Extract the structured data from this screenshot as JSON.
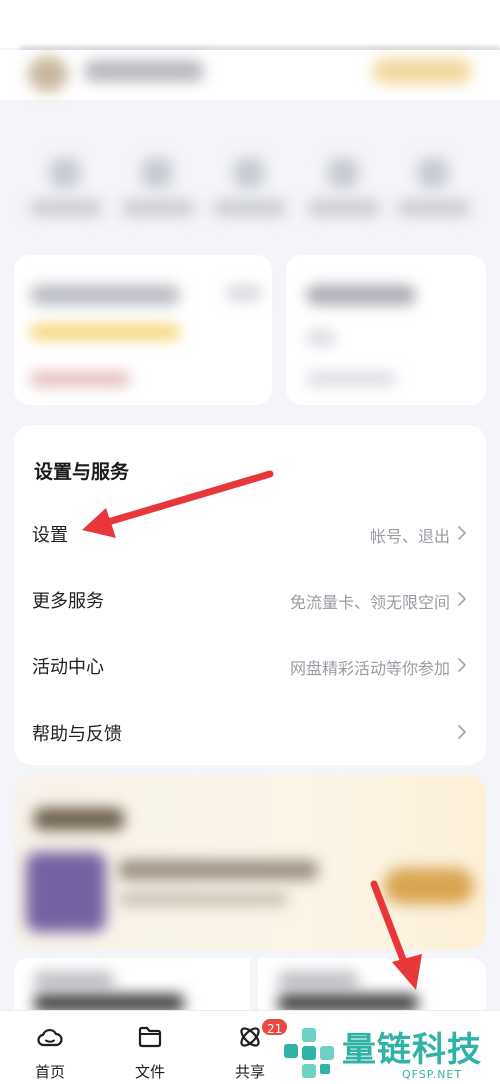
{
  "settings_section": {
    "title": "设置与服务",
    "rows": [
      {
        "label": "设置",
        "value": "帐号、退出"
      },
      {
        "label": "更多服务",
        "value": "免流量卡、领无限空间"
      },
      {
        "label": "活动中心",
        "value": "网盘精彩活动等你参加"
      },
      {
        "label": "帮助与反馈",
        "value": ""
      }
    ]
  },
  "tabbar": {
    "tabs": [
      {
        "label": "首页",
        "icon": "cloud-home-icon"
      },
      {
        "label": "文件",
        "icon": "folder-icon"
      },
      {
        "label": "共享",
        "icon": "share-orbit-icon",
        "badge": "21"
      }
    ]
  },
  "watermark": {
    "text": "量链科技",
    "sub": "QFSP.NET"
  },
  "colors": {
    "annotation_arrow": "#e8373a",
    "watermark": "#2fb3a6",
    "badge": "#e7483f"
  }
}
